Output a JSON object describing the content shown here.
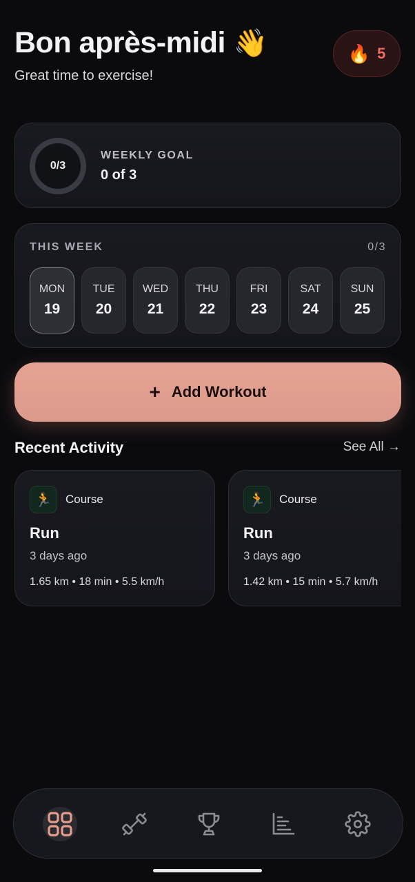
{
  "header": {
    "greeting": "Bon après-midi",
    "greeting_emoji": "👋",
    "subtitle": "Great time to exercise!",
    "streak_icon": "🔥",
    "streak_count": "5"
  },
  "weekly_goal": {
    "ring_label": "0/3",
    "label": "WEEKLY GOAL",
    "value": "0 of 3",
    "progress_fraction": 0
  },
  "this_week": {
    "title": "THIS WEEK",
    "count": "0/3",
    "days": [
      {
        "name": "MON",
        "num": "19",
        "active": true
      },
      {
        "name": "TUE",
        "num": "20"
      },
      {
        "name": "WED",
        "num": "21"
      },
      {
        "name": "THU",
        "num": "22"
      },
      {
        "name": "FRI",
        "num": "23"
      },
      {
        "name": "SAT",
        "num": "24"
      },
      {
        "name": "SUN",
        "num": "25"
      }
    ]
  },
  "add_workout": {
    "icon": "+",
    "label": "Add Workout"
  },
  "recent_activity": {
    "title": "Recent Activity",
    "see_all": "See All →",
    "items": [
      {
        "icon": "🏃",
        "category": "Course",
        "name": "Run",
        "time": "3 days ago",
        "stats": "1.65 km • 18 min • 5.5 km/h"
      },
      {
        "icon": "🏃",
        "category": "Course",
        "name": "Run",
        "time": "3 days ago",
        "stats": "1.42 km • 15 min • 5.7 km/h"
      }
    ]
  },
  "nav": {
    "items": [
      {
        "icon": "dashboard-icon",
        "active": true
      },
      {
        "icon": "dumbbell-icon"
      },
      {
        "icon": "trophy-icon"
      },
      {
        "icon": "bar-chart-icon"
      },
      {
        "icon": "settings-icon"
      }
    ]
  },
  "colors": {
    "accent": "#e09e90",
    "streak": "#ef6b5e",
    "background": "#0b0b0e"
  }
}
